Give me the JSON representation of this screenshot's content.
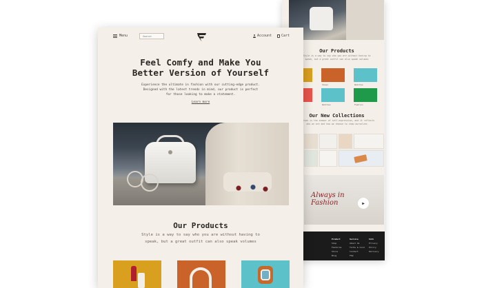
{
  "back_page": {
    "products_title": "Our Products",
    "products_sub_line1": "Style is a way to say who you are without having to",
    "products_sub_line2": "speak, but a great outfit can also speak volumes",
    "tile_labels": [
      "Shoes",
      "Watches",
      "Watches",
      "Fashion"
    ],
    "collections_title": "Our New Collections",
    "collections_sub_line1": "Fashion is the armour of self-expression, and it reflects",
    "collections_sub_line2": "who we are and how we choose to show ourselves",
    "fashion_text_line1": "Always in",
    "fashion_text_line2": "Fashion",
    "footer_cols": [
      {
        "head": "Product",
        "items": [
          "Shop",
          "Features",
          "Store",
          "Blog"
        ]
      },
      {
        "head": "Service",
        "items": [
          "About Us",
          "Terms & Cond",
          "Contact",
          "FAQ"
        ]
      },
      {
        "head": "Info",
        "items": [
          "Privacy Policy",
          "Delivery"
        ]
      }
    ]
  },
  "nav": {
    "menu_label": "Menu",
    "search_placeholder": "Search",
    "account_label": "Account",
    "cart_label": "Cart"
  },
  "hero": {
    "title_line1": "Feel Comfy and Make You",
    "title_line2": "Better Version of Yourself",
    "sub_line1": "Experience the ultimate in fashion with our cutting-edge product.",
    "sub_line2": "Designed with the latest trends in mind, our product is perfect",
    "sub_line3": "for those looking to make a statement.",
    "learn_more": "Learn more"
  },
  "products": {
    "title": "Our Products",
    "sub_line1": "Style is a way to say who you are without having to",
    "sub_line2": "speak, but a great outfit can also speak volumes"
  },
  "colors": {
    "page_bg": "#f4efe8",
    "text": "#2a2622",
    "tile_mustard": "#d9a020",
    "tile_orange": "#c9632a",
    "tile_teal": "#5dc1c9",
    "footer_bg": "#1b1b1b",
    "fashion_red": "#8c1f22"
  },
  "icons": [
    "menu-icon",
    "search-input",
    "brand-logo-icon",
    "user-icon",
    "bag-icon",
    "play-icon"
  ]
}
